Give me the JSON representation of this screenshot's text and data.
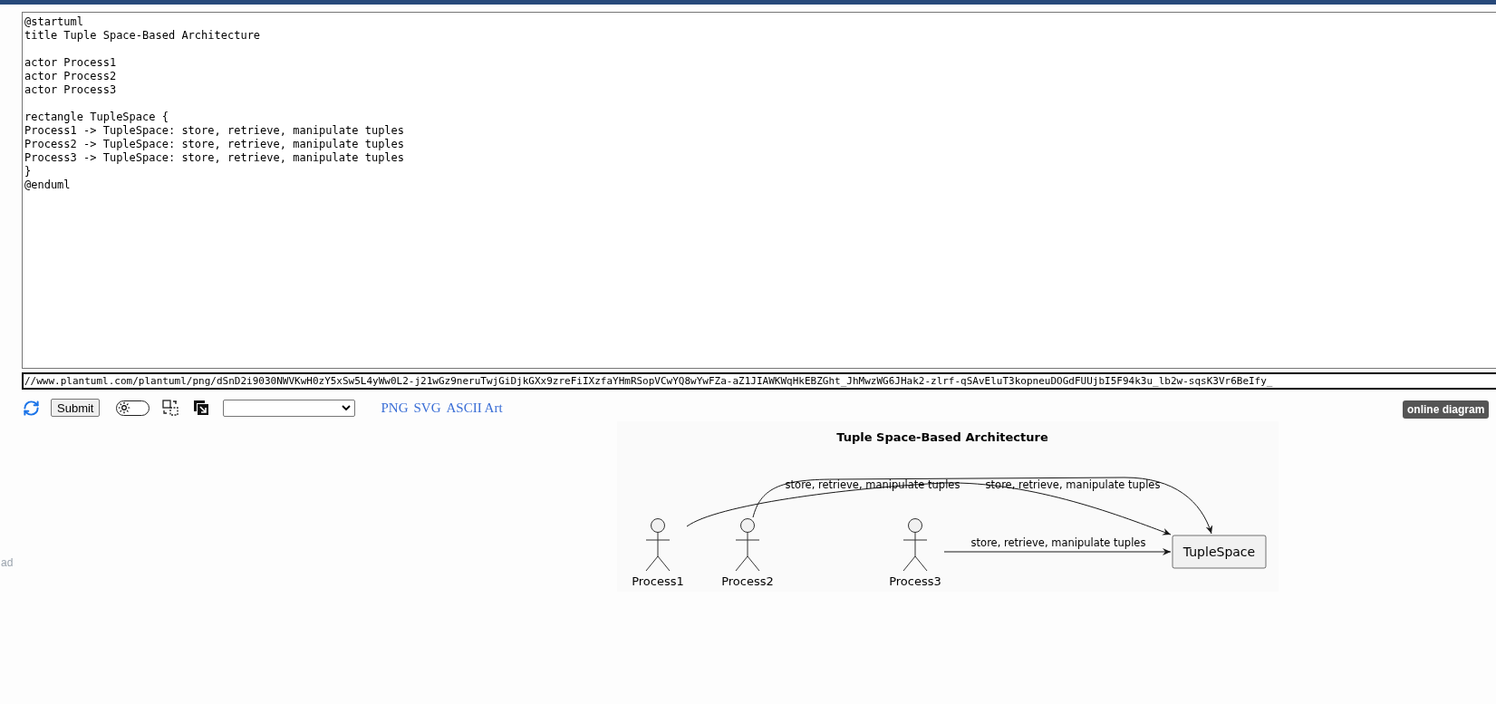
{
  "editor": {
    "text": "@startuml\ntitle Tuple Space-Based Architecture\n\nactor Process1\nactor Process2\nactor Process3\n\nrectangle TupleSpace {\nProcess1 -> TupleSpace: store, retrieve, manipulate tuples\nProcess2 -> TupleSpace: store, retrieve, manipulate tuples\nProcess3 -> TupleSpace: store, retrieve, manipulate tuples\n}\n@enduml"
  },
  "url_field": {
    "value": "//www.plantuml.com/plantuml/png/dSnD2i9030NWVKwH0zY5xSw5L4yWw0L2-j21wGz9neruTwjGiDjkGXx9zreFiIXzfaYHmRSopVCwYQ8wYwFZa-aZ1JIAWKWqHkEBZGht_JhMwzWG6JHak2-zlrf-qSAvEluT3kopneuDOGdFUUjbI5F94k3u_lb2w-sqsK3Vr6BeIfy_"
  },
  "toolbar": {
    "submit": "Submit",
    "theme_toggle": {
      "on": false
    },
    "links": [
      "PNG",
      "SVG",
      "ASCII Art"
    ],
    "badge": "online diagram"
  },
  "diagram": {
    "title": "Tuple Space-Based Architecture",
    "actors": [
      {
        "name": "Process1"
      },
      {
        "name": "Process2"
      },
      {
        "name": "Process3"
      }
    ],
    "rectangle": {
      "label": "TupleSpace"
    },
    "arrows": [
      {
        "label": "store, retrieve, manipulate tuples"
      },
      {
        "label": "store, retrieve, manipulate tuples"
      },
      {
        "label": "store, retrieve, manipulate tuples"
      }
    ]
  },
  "side_text": "ad"
}
